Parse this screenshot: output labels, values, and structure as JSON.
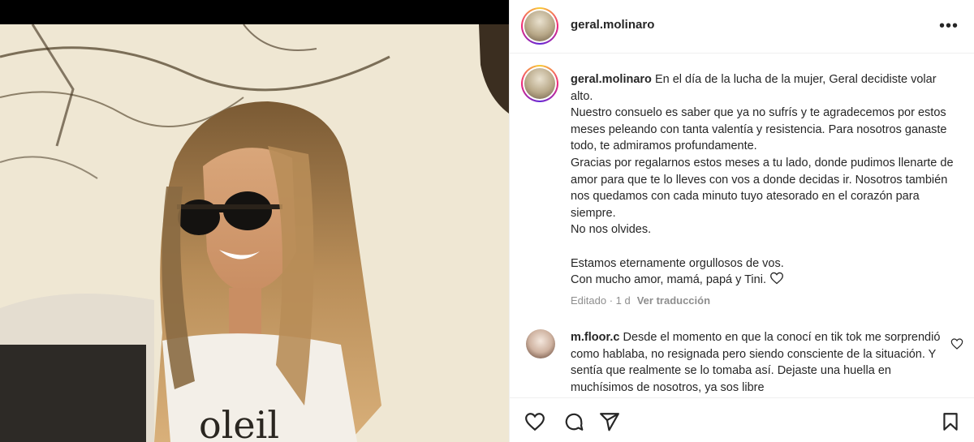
{
  "post": {
    "username": "geral.molinaro",
    "caption_lines": "En el día de la lucha de la mujer, Geral decidiste volar alto.\nNuestro consuelo es saber que ya no sufrís y te agradecemos por estos meses peleando con tanta valentía y resistencia. Para nosotros ganaste todo, te admiramos profundamente.\nGracias por regalarnos estos meses a tu lado, donde pudimos llenarte de amor para que te lo lleves con vos a donde decidas ir. Nosotros también nos quedamos con cada minuto tuyo atesorado en el corazón para siempre.\nNo nos olvides.\n\nEstamos eternamente orgullosos de vos.\nCon mucho amor, mamá, papá y Tini.",
    "edited_time": "Editado · 1 d",
    "translate_label": "Ver traducción",
    "photo_shirt_text": "oleil"
  },
  "comment": {
    "username": "m.floor.c",
    "text": "Desde el momento en que la conocí en tik tok me sorprendió como hablaba, no resignada pero siendo consciente de la situación. Y sentía que realmente se lo tomaba así. Dejaste una huella en muchísimos de nosotros, ya sos libre"
  },
  "icons": {
    "more": "more-options-icon",
    "like": "heart-icon",
    "comment": "comment-icon",
    "share": "share-icon",
    "save": "bookmark-icon"
  }
}
